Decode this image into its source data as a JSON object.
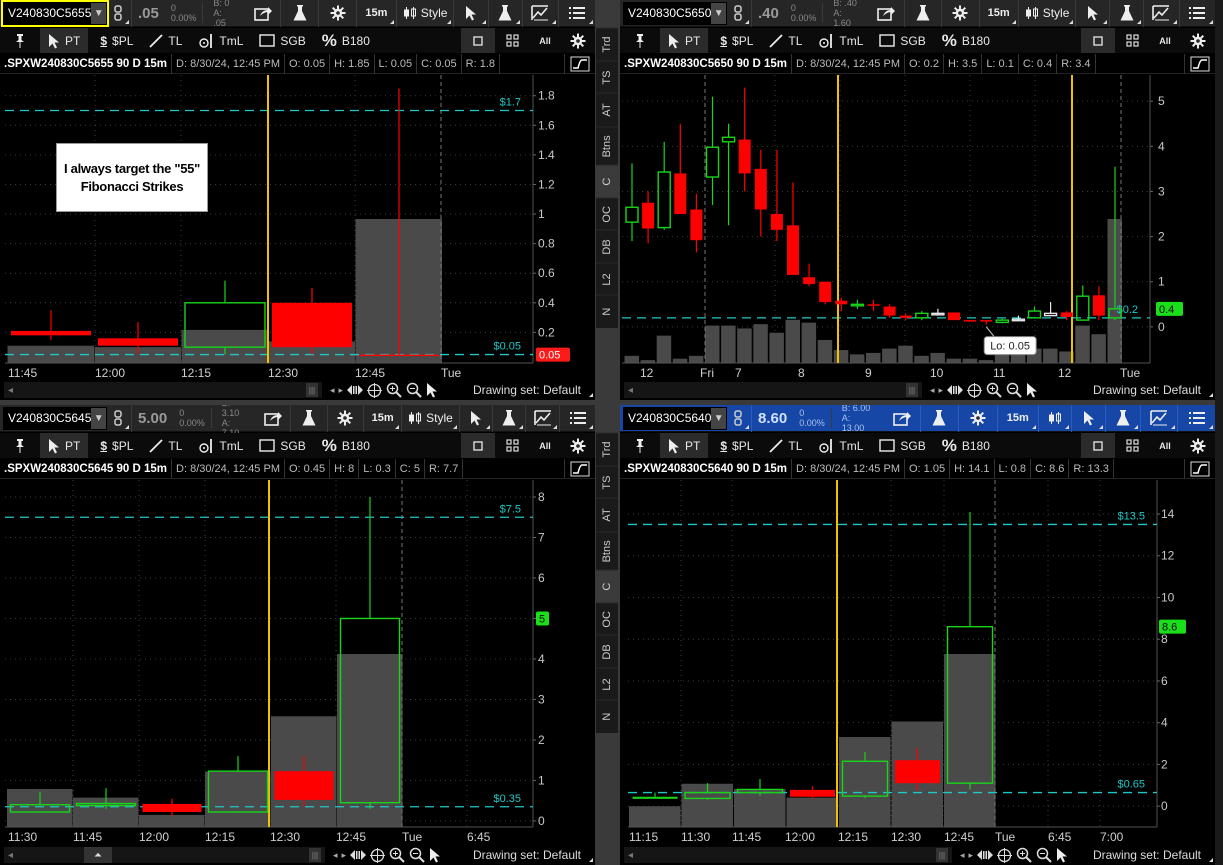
{
  "common": {
    "drawing_tools": [
      "PT",
      "$PL",
      "TL",
      "TmL",
      "SGB",
      "B180"
    ],
    "all_label": "All",
    "style_label": "Style",
    "drawing_set": "Drawing set: Default",
    "side_tabs": [
      "Trd",
      "TS",
      "AT",
      "Btns",
      "C",
      "OC",
      "DB",
      "L2",
      "N"
    ],
    "side_tab_selected": "C"
  },
  "annotation": "I always target the \"55\" Fibonacci Strikes",
  "colors": {
    "up": "#19d419",
    "down": "#ff0000",
    "level": "#1fc8c8",
    "marker": "#f2c200",
    "volume": "#4a4a4a",
    "active_border": "#ffff00",
    "linked_header": "#1747a6"
  },
  "panels": [
    {
      "symbol": "V240830C5655",
      "last": ".05",
      "change": "0",
      "change_pct": "0.00%",
      "bid": "B: 0",
      "ask": "A: .05",
      "timeframe": "15m",
      "show_style": true,
      "title": ".SPXW240830C5655 90 D 15m",
      "date": "D: 8/30/24, 12:45 PM",
      "open": "O: 0.05",
      "high": "H: 1.85",
      "low": "L: 0.05",
      "close": "C: 0.05",
      "range": "R: 1.8",
      "price_ticks": [
        "0.2",
        "0.4",
        "0.6",
        "0.8",
        "1",
        "1.2",
        "1.4",
        "1.6",
        "1.8"
      ],
      "time_labels": [
        "11:45",
        "12:00",
        "12:15",
        "12:30",
        "12:45",
        "Tue"
      ],
      "levels": [
        {
          "value": 1.7,
          "label": "$1.7"
        },
        {
          "value": 0.05,
          "label": "$0.05"
        }
      ],
      "badge": {
        "value": 0.05,
        "text": "0.05",
        "color": "#ff1a1a"
      },
      "candles": [
        {
          "o": 0.21,
          "h": 0.35,
          "l": 0.15,
          "c": 0.18,
          "t": "down",
          "v": 12
        },
        {
          "o": 0.16,
          "h": 0.27,
          "l": 0.05,
          "c": 0.11,
          "t": "down",
          "v": 11
        },
        {
          "o": 0.1,
          "h": 0.55,
          "l": 0.05,
          "c": 0.4,
          "t": "up",
          "v": 23
        },
        {
          "o": 0.4,
          "h": 0.5,
          "l": 0.05,
          "c": 0.1,
          "t": "down",
          "v": 15
        },
        {
          "o": 0.05,
          "h": 1.85,
          "l": 0.05,
          "c": 0.05,
          "t": "down",
          "v": 100
        }
      ]
    },
    {
      "symbol": "V240830C5650",
      "last": ".40",
      "change": "0",
      "change_pct": "0.00%",
      "bid": "B: .40",
      "ask": "A: 1.60",
      "timeframe": "15m",
      "show_style": true,
      "title": ".SPXW240830C5650 90 D 15m",
      "date": "D: 8/30/24, 12:45 PM",
      "open": "O: 0.2",
      "high": "H: 3.5",
      "low": "L: 0.1",
      "close": "C: 0.4",
      "range": "R: 3.4",
      "price_ticks": [
        "0",
        "1",
        "2",
        "3",
        "4",
        "5"
      ],
      "time_labels": [
        "12",
        "Fri",
        "7",
        "8",
        "9",
        "10",
        "11",
        "12",
        "Tue"
      ],
      "levels": [
        {
          "value": 0.2,
          "label": "$0.2"
        }
      ],
      "badge": {
        "value": 0.4,
        "text": "0.4",
        "color": "#19e019"
      },
      "tooltip": "Lo: 0.05",
      "candles": [
        {
          "o": 2.32,
          "h": 3.62,
          "l": 1.9,
          "c": 2.65,
          "t": "up",
          "v": 5
        },
        {
          "o": 2.75,
          "h": 3.0,
          "l": 1.85,
          "c": 2.18,
          "t": "down",
          "v": 2
        },
        {
          "o": 2.2,
          "h": 4.1,
          "l": 2.15,
          "c": 3.43,
          "t": "up",
          "v": 19
        },
        {
          "o": 3.4,
          "h": 4.5,
          "l": 2.5,
          "c": 2.5,
          "t": "down",
          "v": 3
        },
        {
          "o": 2.6,
          "h": 2.95,
          "l": 1.65,
          "c": 1.92,
          "t": "down",
          "v": 5
        },
        {
          "o": 3.32,
          "h": 5.1,
          "l": 2.7,
          "c": 3.98,
          "t": "up",
          "v": 26
        },
        {
          "o": 4.1,
          "h": 4.5,
          "l": 2.25,
          "c": 4.2,
          "t": "up",
          "v": 26
        },
        {
          "o": 4.15,
          "h": 5.3,
          "l": 3.0,
          "c": 3.4,
          "t": "down",
          "v": 24
        },
        {
          "o": 3.5,
          "h": 3.92,
          "l": 2.0,
          "c": 2.6,
          "t": "down",
          "v": 27
        },
        {
          "o": 2.5,
          "h": 3.92,
          "l": 1.9,
          "c": 2.15,
          "t": "down",
          "v": 21
        },
        {
          "o": 2.25,
          "h": 3.2,
          "l": 1.15,
          "c": 1.15,
          "t": "down",
          "v": 30
        },
        {
          "o": 1.1,
          "h": 1.4,
          "l": 0.9,
          "c": 0.95,
          "t": "down",
          "v": 28
        },
        {
          "o": 1.0,
          "h": 1.0,
          "l": 0.5,
          "c": 0.55,
          "t": "down",
          "v": 16
        },
        {
          "o": 0.58,
          "h": 0.65,
          "l": 0.35,
          "c": 0.5,
          "t": "down",
          "v": 9
        },
        {
          "o": 0.5,
          "h": 0.6,
          "l": 0.4,
          "c": 0.5,
          "t": "up",
          "v": 6
        },
        {
          "o": 0.5,
          "h": 0.6,
          "l": 0.35,
          "c": 0.47,
          "t": "down",
          "v": 7
        },
        {
          "o": 0.45,
          "h": 0.5,
          "l": 0.2,
          "c": 0.25,
          "t": "down",
          "v": 10
        },
        {
          "o": 0.25,
          "h": 0.3,
          "l": 0.15,
          "c": 0.2,
          "t": "down",
          "v": 12
        },
        {
          "o": 0.2,
          "h": 0.35,
          "l": 0.15,
          "c": 0.3,
          "t": "up",
          "v": 5
        },
        {
          "o": 0.3,
          "h": 0.4,
          "l": 0.25,
          "c": 0.3,
          "t": "neutral",
          "v": 7
        },
        {
          "o": 0.32,
          "h": 0.32,
          "l": 0.15,
          "c": 0.15,
          "t": "down",
          "v": 3
        },
        {
          "o": 0.15,
          "h": 0.15,
          "l": 0.12,
          "c": 0.13,
          "t": "down",
          "v": 3
        },
        {
          "o": 0.15,
          "h": 0.15,
          "l": 0.05,
          "c": 0.12,
          "t": "down",
          "v": 2
        },
        {
          "o": 0.1,
          "h": 0.18,
          "l": 0.08,
          "c": 0.15,
          "t": "up",
          "v": 10
        },
        {
          "o": 0.17,
          "h": 0.25,
          "l": 0.13,
          "c": 0.17,
          "t": "neutral",
          "v": 10
        },
        {
          "o": 0.2,
          "h": 0.45,
          "l": 0.2,
          "c": 0.35,
          "t": "up",
          "v": 10
        },
        {
          "o": 0.25,
          "h": 0.55,
          "l": 0.25,
          "c": 0.3,
          "t": "neutral",
          "v": 10
        },
        {
          "o": 0.32,
          "h": 0.35,
          "l": 0.15,
          "c": 0.22,
          "t": "down",
          "v": 8
        },
        {
          "o": 0.15,
          "h": 0.92,
          "l": 0.15,
          "c": 0.68,
          "t": "up",
          "v": 26
        },
        {
          "o": 0.7,
          "h": 0.9,
          "l": 0.15,
          "c": 0.25,
          "t": "down",
          "v": 20
        },
        {
          "o": 0.2,
          "h": 3.55,
          "l": 0.15,
          "c": 0.4,
          "t": "up",
          "v": 100
        }
      ]
    },
    {
      "symbol": "V240830C5645",
      "last": "5.00",
      "change": "0",
      "change_pct": "0.00%",
      "bid": "B: 3.10",
      "ask": "A: 7.10",
      "timeframe": "15m",
      "show_style": true,
      "title": ".SPXW240830C5645 90 D 15m",
      "date": "D: 8/30/24, 12:45 PM",
      "open": "O: 0.45",
      "high": "H: 8",
      "low": "L: 0.3",
      "close": "C: 5",
      "range": "R: 7.7",
      "price_ticks": [
        "0",
        "1",
        "2",
        "3",
        "4",
        "5",
        "6",
        "7",
        "8"
      ],
      "time_labels": [
        "11:30",
        "11:45",
        "12:00",
        "12:15",
        "12:30",
        "12:45",
        "Tue",
        "6:45"
      ],
      "levels": [
        {
          "value": 7.5,
          "label": "$7.5"
        },
        {
          "value": 0.35,
          "label": "$0.35"
        }
      ],
      "badge": {
        "value": 5,
        "text": "5",
        "color": "#19e019"
      },
      "candles": [
        {
          "o": 0.22,
          "h": 0.72,
          "l": 0.2,
          "c": 0.4,
          "t": "up",
          "v": 22
        },
        {
          "o": 0.38,
          "h": 0.81,
          "l": 0.3,
          "c": 0.43,
          "t": "up",
          "v": 17
        },
        {
          "o": 0.42,
          "h": 0.55,
          "l": 0.12,
          "c": 0.22,
          "t": "down",
          "v": 7
        },
        {
          "o": 0.22,
          "h": 1.6,
          "l": 0.2,
          "c": 1.23,
          "t": "up",
          "v": 32
        },
        {
          "o": 1.23,
          "h": 1.62,
          "l": 0.35,
          "c": 0.52,
          "t": "down",
          "v": 64
        },
        {
          "o": 0.45,
          "h": 8.0,
          "l": 0.3,
          "c": 5.0,
          "t": "up",
          "v": 100
        }
      ]
    },
    {
      "symbol": "V240830C5640",
      "last": "8.60",
      "change": "0",
      "change_pct": "0.00%",
      "bid": "B: 6.00",
      "ask": "A: 13.00",
      "timeframe": "15m",
      "show_style": false,
      "title": ".SPXW240830C5640 90 D 15m",
      "date": "D: 8/30/24, 12:45 PM",
      "open": "O: 1.05",
      "high": "H: 14.1",
      "low": "L: 0.8",
      "close": "C: 8.6",
      "range": "R: 13.3",
      "price_ticks": [
        "0",
        "2",
        "4",
        "6",
        "8",
        "10",
        "12",
        "14"
      ],
      "time_labels": [
        "11:15",
        "11:30",
        "11:45",
        "12:00",
        "12:15",
        "12:30",
        "12:45",
        "Tue",
        "6:45",
        "7:00"
      ],
      "levels": [
        {
          "value": 13.5,
          "label": "$13.5"
        },
        {
          "value": 0.65,
          "label": "$0.65"
        }
      ],
      "badge": {
        "value": 8.6,
        "text": "8.6",
        "color": "#19e019"
      },
      "candles": [
        {
          "o": 0.35,
          "h": 0.65,
          "l": 0.35,
          "c": 0.45,
          "t": "up_filled",
          "v": 12
        },
        {
          "o": 0.37,
          "h": 1.1,
          "l": 0.3,
          "c": 0.65,
          "t": "up",
          "v": 25
        },
        {
          "o": 0.65,
          "h": 1.3,
          "l": 0.5,
          "c": 0.8,
          "t": "up",
          "v": 22
        },
        {
          "o": 0.78,
          "h": 0.95,
          "l": 0.35,
          "c": 0.45,
          "t": "down",
          "v": 17
        },
        {
          "o": 0.48,
          "h": 2.6,
          "l": 0.4,
          "c": 2.15,
          "t": "up",
          "v": 52
        },
        {
          "o": 2.2,
          "h": 2.8,
          "l": 0.75,
          "c": 1.1,
          "t": "down",
          "v": 61
        },
        {
          "o": 1.1,
          "h": 14.1,
          "l": 0.8,
          "c": 8.6,
          "t": "up",
          "v": 100
        }
      ]
    }
  ]
}
